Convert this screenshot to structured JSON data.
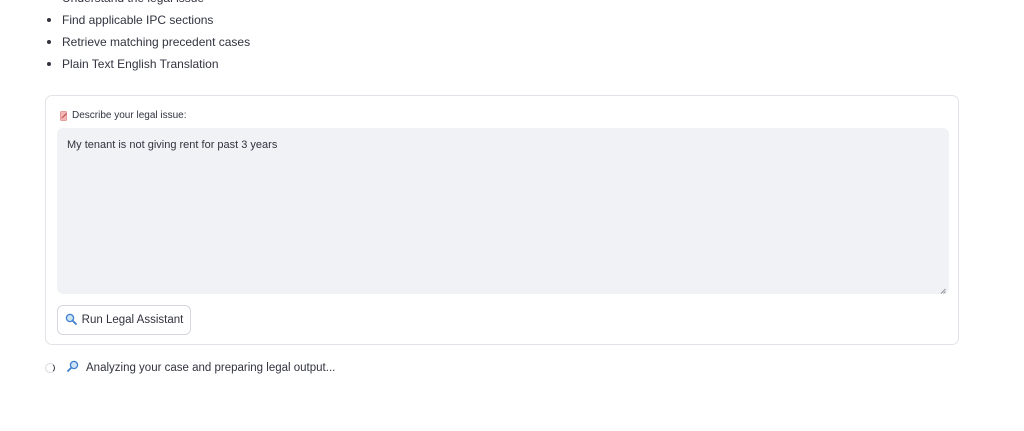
{
  "features": {
    "items": [
      "Understand the legal issue",
      "Find applicable IPC sections",
      "Retrieve matching precedent cases",
      "Plain Text English Translation"
    ]
  },
  "form": {
    "label": "Describe your legal issue:",
    "label_icon": "memo-icon",
    "textarea_value": "My tenant is not giving rent for past 3 years",
    "run_button_label": "Run Legal Assistant",
    "run_button_icon": "magnifier-left-icon"
  },
  "status": {
    "icon": "magnifier-right-icon",
    "text": "Analyzing your case and preparing legal output..."
  },
  "colors": {
    "text": "#31333f",
    "textarea_bg": "#f0f2f6",
    "border": "#e1e3e8",
    "magnifier_blue": "#3f7fcf"
  }
}
